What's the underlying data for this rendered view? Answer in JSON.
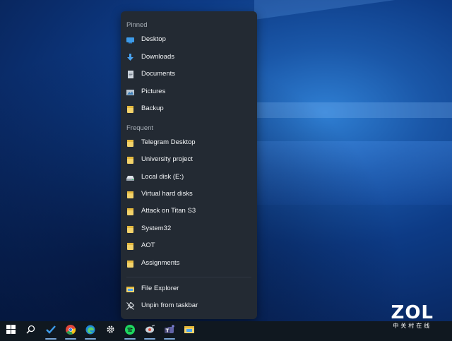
{
  "jumplist": {
    "pinned_header": "Pinned",
    "pinned": [
      {
        "label": "Desktop",
        "icon": "desktop-icon"
      },
      {
        "label": "Downloads",
        "icon": "downloads-icon"
      },
      {
        "label": "Documents",
        "icon": "documents-icon"
      },
      {
        "label": "Pictures",
        "icon": "pictures-icon"
      },
      {
        "label": "Backup",
        "icon": "folder-icon"
      }
    ],
    "frequent_header": "Frequent",
    "frequent": [
      {
        "label": "Telegram Desktop",
        "icon": "folder-icon"
      },
      {
        "label": "University project",
        "icon": "folder-icon"
      },
      {
        "label": "Local disk (E:)",
        "icon": "drive-icon"
      },
      {
        "label": "Virtual hard disks",
        "icon": "folder-icon"
      },
      {
        "label": "Attack on Titan S3",
        "icon": "folder-icon"
      },
      {
        "label": "System32",
        "icon": "folder-icon"
      },
      {
        "label": "AOT",
        "icon": "folder-icon"
      },
      {
        "label": "Assignments",
        "icon": "folder-icon"
      }
    ],
    "actions": [
      {
        "label": "File Explorer",
        "icon": "file-explorer-icon"
      },
      {
        "label": "Unpin from taskbar",
        "icon": "unpin-icon"
      }
    ]
  },
  "taskbar": {
    "items": [
      "start-icon",
      "search-icon",
      "todo-icon",
      "chrome-icon",
      "edge-icon",
      "settings-icon",
      "spotify-icon",
      "sniffer-icon",
      "teams-icon",
      "file-explorer-icon"
    ]
  },
  "colors": {
    "jumplist_bg": "#232a33",
    "taskbar_bg": "#101820",
    "folder": "#f3d36b",
    "accent": "#4aa3f0"
  },
  "watermark": {
    "logo": "ZOL",
    "sub": "中关村在线"
  }
}
